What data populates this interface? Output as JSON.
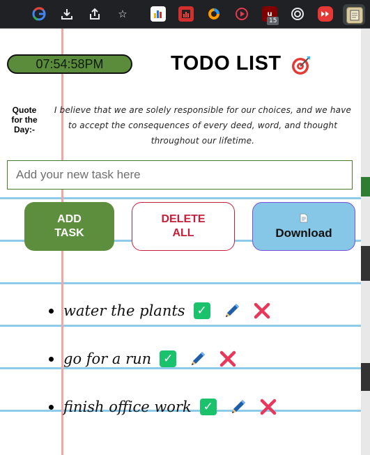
{
  "browser": {
    "icons": [
      "google-icon",
      "download-icon",
      "share-icon",
      "star-icon"
    ],
    "extension_badge": "15"
  },
  "app": {
    "clock": "07:54:58PM",
    "title": "TODO LIST",
    "quote_label": "Quote for the Day:-",
    "quote_text": "I believe that we are solely responsible for our choices, and we have to accept the consequences of every deed, word, and thought throughout our lifetime."
  },
  "input": {
    "placeholder": "Add your new task here",
    "value": ""
  },
  "buttons": {
    "add": "ADD TASK",
    "delete_all": "DELETE ALL",
    "download": "Download"
  },
  "todos": [
    {
      "text": "water the plants"
    },
    {
      "text": "go for a run"
    },
    {
      "text": "finish office work"
    }
  ],
  "colors": {
    "accent_green": "#5d8e3d",
    "delete_red": "#c41e3a",
    "download_blue": "#86c6e6",
    "check_green": "#19c26b",
    "x_red": "#e8375a"
  }
}
